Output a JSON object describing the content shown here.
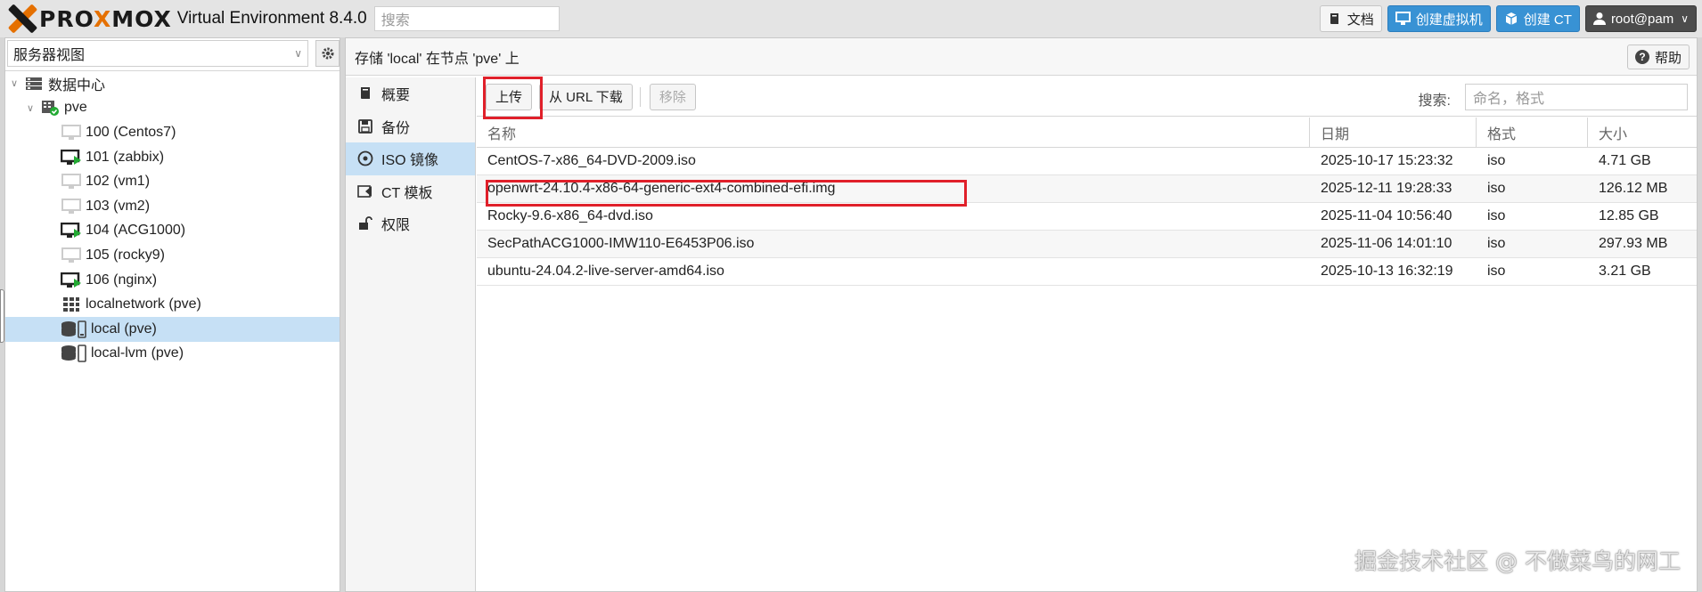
{
  "topbar": {
    "brand_left": "PRO",
    "brand_o": "X",
    "brand_mid": "MO",
    "brand_right": "X",
    "title": "Virtual Environment 8.4.0",
    "search_placeholder": "搜索",
    "docs": "文档",
    "create_vm": "创建虚拟机",
    "create_ct": "创建 CT",
    "user": "root@pam"
  },
  "left": {
    "view": "服务器视图",
    "tree": [
      {
        "label": "数据中心",
        "icon": "datacenter-icon"
      },
      {
        "label": "pve",
        "icon": "node-online-icon"
      },
      {
        "label": "100 (Centos7)",
        "icon": "vm-stopped-icon"
      },
      {
        "label": "101 (zabbix)",
        "icon": "vm-running-icon"
      },
      {
        "label": "102 (vm1)",
        "icon": "vm-stopped-icon"
      },
      {
        "label": "103 (vm2)",
        "icon": "vm-stopped-icon"
      },
      {
        "label": "104 (ACG1000)",
        "icon": "vm-running-icon"
      },
      {
        "label": "105 (rocky9)",
        "icon": "vm-stopped-icon"
      },
      {
        "label": "106 (nginx)",
        "icon": "vm-running-icon"
      },
      {
        "label": "localnetwork (pve)",
        "icon": "sdn-grid-icon"
      },
      {
        "label": "local (pve)",
        "icon": "storage-icon"
      },
      {
        "label": "local-lvm (pve)",
        "icon": "storage-icon"
      }
    ]
  },
  "right": {
    "header": "存储 'local' 在节点 'pve' 上",
    "help": "帮助",
    "nav": [
      "概要",
      "备份",
      "ISO 镜像",
      "CT 模板",
      "权限"
    ],
    "toolbar": {
      "upload": "上传",
      "download_url": "从 URL 下载",
      "remove": "移除",
      "search_label": "搜索:",
      "search_placeholder": "命名，格式"
    },
    "columns": [
      "名称",
      "日期",
      "格式",
      "大小"
    ],
    "rows": [
      {
        "name": "CentOS-7-x86_64-DVD-2009.iso",
        "date": "2025-10-17 15:23:32",
        "format": "iso",
        "size": "4.71 GB"
      },
      {
        "name": "openwrt-24.10.4-x86-64-generic-ext4-combined-efi.img",
        "date": "2025-12-11 19:28:33",
        "format": "iso",
        "size": "126.12 MB"
      },
      {
        "name": "Rocky-9.6-x86_64-dvd.iso",
        "date": "2025-11-04 10:56:40",
        "format": "iso",
        "size": "12.85 GB"
      },
      {
        "name": "SecPathACG1000-IMW110-E6453P06.iso",
        "date": "2025-11-06 14:01:10",
        "format": "iso",
        "size": "297.93 MB"
      },
      {
        "name": "ubuntu-24.04.2-live-server-amd64.iso",
        "date": "2025-10-13 16:32:19",
        "format": "iso",
        "size": "3.21 GB"
      }
    ]
  },
  "watermark": "掘金技术社区 @ 不做菜鸟的网工",
  "colors": {
    "accent": "#e57000",
    "primary_button": "#3892d4",
    "selection": "#c6e0f5",
    "highlight_box": "#e0202a",
    "running": "#22aa33"
  }
}
